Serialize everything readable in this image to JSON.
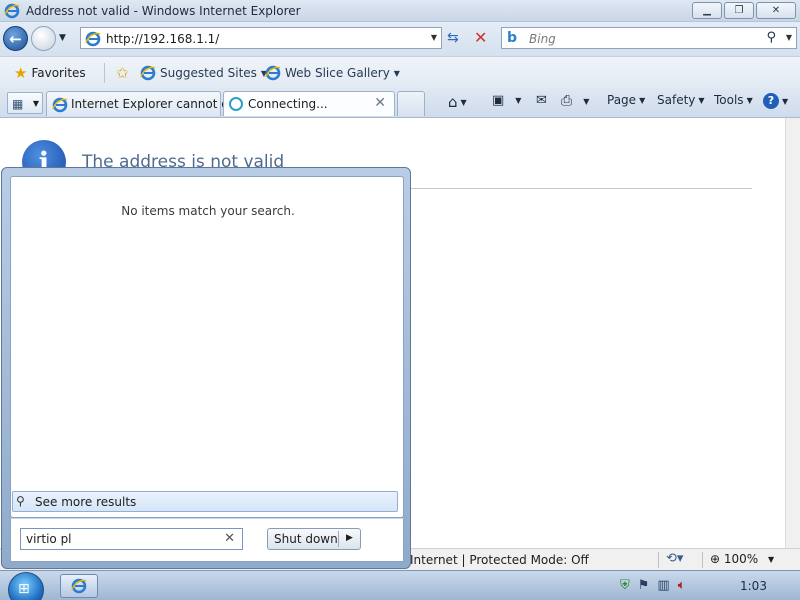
{
  "window": {
    "title": "Address not valid - Windows Internet Explorer"
  },
  "address": {
    "url": "http://192.168.1.1/"
  },
  "search": {
    "placeholder": "Bing"
  },
  "favorites_bar": {
    "favorites_label": "Favorites",
    "items": [
      {
        "label": "Suggested Sites"
      },
      {
        "label": "Web Slice Gallery"
      }
    ]
  },
  "tabs": [
    {
      "label": "Internet Explorer cannot d..."
    },
    {
      "label": "Connecting..."
    }
  ],
  "command_bar": {
    "page": "Page",
    "safety": "Safety",
    "tools": "Tools"
  },
  "content": {
    "error_title": "The address is not valid"
  },
  "status_bar": {
    "zone": "Internet | Protected Mode: Off",
    "zoom": "100%"
  },
  "start_menu": {
    "no_items": "No items match your search.",
    "see_more": "See more results",
    "search_value": "virtio pl",
    "shutdown_label": "Shut down"
  },
  "taskbar": {
    "clock": "1:03"
  },
  "icons": [
    "ie-icon",
    "back-arrow-icon",
    "forward-arrow-icon",
    "refresh-icon",
    "stop-icon",
    "bing-icon",
    "search-icon",
    "favorites-star-icon",
    "add-favorites-icon",
    "home-icon",
    "feeds-icon",
    "mail-icon",
    "print-icon",
    "help-icon",
    "info-icon",
    "windows-start-icon",
    "action-center-flag-icon",
    "network-icon",
    "volume-icon"
  ]
}
